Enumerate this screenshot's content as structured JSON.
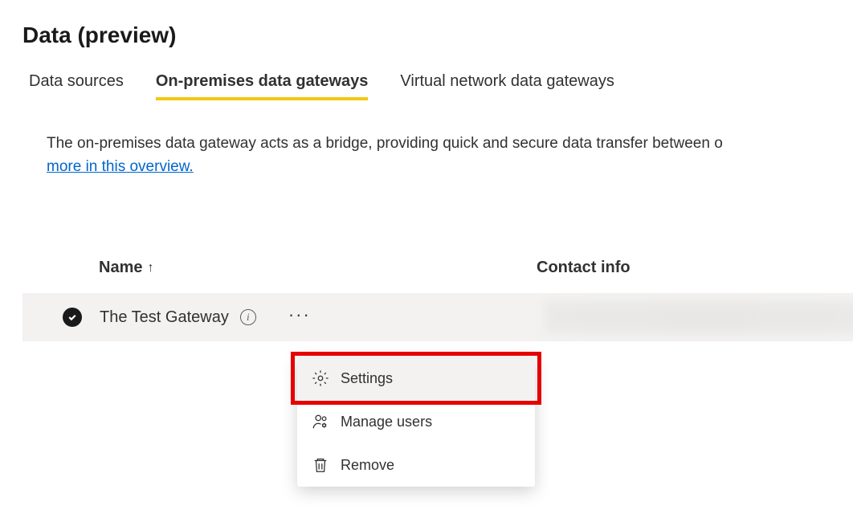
{
  "header": {
    "title": "Data (preview)"
  },
  "tabs": {
    "items": [
      {
        "label": "Data sources",
        "active": false
      },
      {
        "label": "On-premises data gateways",
        "active": true
      },
      {
        "label": "Virtual network data gateways",
        "active": false
      }
    ]
  },
  "description": {
    "text": "The on-premises data gateway acts as a bridge, providing quick and secure data transfer between o",
    "link_text": "more in this overview."
  },
  "table": {
    "columns": {
      "name": "Name",
      "contact": "Contact info"
    },
    "sort_indicator": "↑",
    "rows": [
      {
        "selected": true,
        "name": "The Test Gateway"
      }
    ]
  },
  "context_menu": {
    "items": [
      {
        "icon": "gear-icon",
        "label": "Settings",
        "highlighted": true
      },
      {
        "icon": "users-icon",
        "label": "Manage users",
        "highlighted": false
      },
      {
        "icon": "trash-icon",
        "label": "Remove",
        "highlighted": false
      }
    ]
  }
}
